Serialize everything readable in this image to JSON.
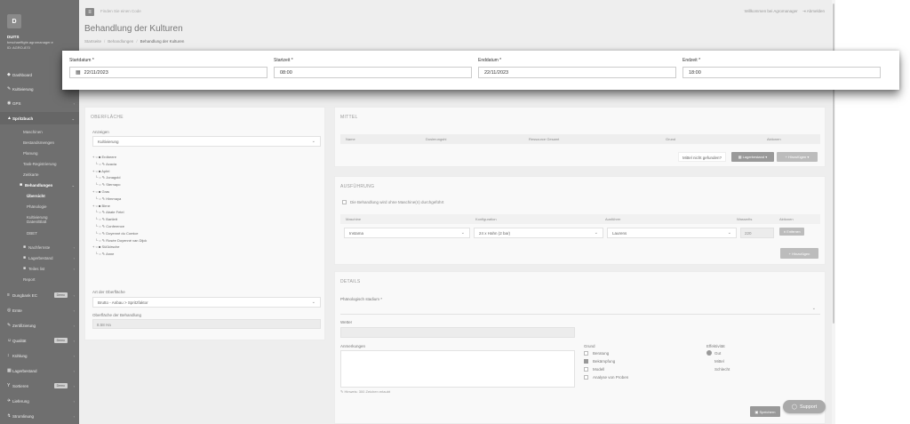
{
  "sidebar": {
    "logo": "D",
    "company": "DUITS",
    "email": "beschaeftigte.agromanager.e",
    "id_line": "ID: AGRO-870",
    "items": [
      {
        "label": "Dashboard",
        "icon": "◆"
      },
      {
        "label": "Kultivierung",
        "icon": "✎"
      },
      {
        "label": "GPS",
        "icon": "◉"
      },
      {
        "label": "Spritzbuch",
        "icon": "▲"
      }
    ],
    "sub_items": [
      {
        "label": "Maschinen"
      },
      {
        "label": "Bestandsmengen"
      },
      {
        "label": "Planung"
      },
      {
        "label": "Task-Registrierung"
      },
      {
        "label": "Zeitkarte"
      },
      {
        "label": "Behandlungen"
      }
    ],
    "sub2_items": [
      {
        "label": "Übersicht"
      },
      {
        "label": "Phänologie"
      },
      {
        "label": "Kultivierung Daten/Blatt"
      },
      {
        "label": "DBET"
      }
    ],
    "sub_items_b": [
      {
        "label": "Nachfernste"
      },
      {
        "label": "Lagerbestand"
      },
      {
        "label": "Teiles list"
      },
      {
        "label": "Report"
      }
    ],
    "bottom_items": [
      {
        "label": "Dungbank EC",
        "icon": "≡",
        "badge": "Demo"
      },
      {
        "label": "Ernte",
        "icon": "◎"
      },
      {
        "label": "Zertifizierung",
        "icon": "✎"
      },
      {
        "label": "Qualität",
        "icon": "☺",
        "badge": "Demo"
      },
      {
        "label": "Kühlung",
        "icon": "↕"
      },
      {
        "label": "Lagerbestand",
        "icon": "▦"
      },
      {
        "label": "Sortieren",
        "icon": "Y",
        "badge": "Demo"
      },
      {
        "label": "Lieferung",
        "icon": "✈"
      },
      {
        "label": "Stromlinung",
        "icon": "↯"
      }
    ]
  },
  "topbar": {
    "search_placeholder": "Finden Sie einen Code",
    "welcome": "Willkommen bei Agromanager",
    "logout": "Abmelden"
  },
  "page": {
    "title": "Behandlung der Kulturen",
    "breadcrumb": [
      "Startseite",
      "Behandlungen",
      "Behandlung der Kulturen"
    ]
  },
  "date_bar": {
    "start_date_label": "Startdatum *",
    "start_date": "22/11/2023",
    "start_time_label": "Startzeit *",
    "start_time": "08:00",
    "end_date_label": "Enddatum *",
    "end_date": "22/11/2023",
    "end_time_label": "Endzeit *",
    "end_time": "18:00"
  },
  "surface_panel": {
    "title": "OBERFLÄCHE",
    "show_label": "Anzeigen",
    "show_value": "Kultivierung",
    "tree": [
      {
        "label": "Erdbeere",
        "level": 0
      },
      {
        "label": "Acacia",
        "level": 1
      },
      {
        "label": "Apfel",
        "level": 0
      },
      {
        "label": "Jonagold",
        "level": 1
      },
      {
        "label": "Sternapo",
        "level": 1
      },
      {
        "label": "Gras",
        "level": 0
      },
      {
        "label": "Himmaya",
        "level": 1
      },
      {
        "label": "Birne",
        "level": 0
      },
      {
        "label": "Abate Fetel",
        "level": 1
      },
      {
        "label": "Bartlett",
        "level": 1
      },
      {
        "label": "Conference",
        "level": 1
      },
      {
        "label": "Doyenné du Comice",
        "level": 1
      },
      {
        "label": "Rosée Doyenné van Dijck",
        "level": 1
      },
      {
        "label": "Süßkirsche",
        "level": 0
      },
      {
        "label": "Anne",
        "level": 1
      }
    ],
    "surface_type_label": "Art der Oberfläche",
    "surface_type_value": "Brutto - Anbau > Spritzfaktor",
    "treated_label": "Oberfläche der Behandlung",
    "treated_value": "8.58 Ha"
  },
  "means_panel": {
    "title": "MITTEL",
    "columns": [
      "Name",
      "Dosierungshi",
      "Ressource Gesamt",
      "Grund",
      "Aktionen"
    ],
    "not_found": "Mittel nicht gefunden?",
    "stock_button": "Lagerbestand",
    "add_button": "Hinzufügen"
  },
  "execution_panel": {
    "title": "AUSFÜHRUNG",
    "no_machine": "Die Behandlung wird ohne Maschine(n) durchgeführt",
    "columns": [
      "Maschine",
      "Konfiguration",
      "Ausführer",
      "Wasserlts",
      "Aktionen"
    ],
    "row": {
      "machine": "Instama",
      "config": "24 x Hahn (2 bar)",
      "operator": "Laurens",
      "water": "220",
      "action": "Entfernen"
    },
    "add_button": "Hinzufügen"
  },
  "details_panel": {
    "title": "DETAILS",
    "pheno_label": "Phänologisch stadium *",
    "weather_label": "Wetter",
    "notes_label": "Anmerkungen",
    "notes_hint": "Hinweis: 300 Zeichen erlaubt",
    "reason_label": "Grund",
    "reasons": [
      {
        "label": "Beratung",
        "checked": false
      },
      {
        "label": "Bekämpfung",
        "checked": true
      },
      {
        "label": "Modell",
        "checked": false
      },
      {
        "label": "Analyse von Proben",
        "checked": false
      }
    ],
    "effect_label": "Effektivität",
    "effects": [
      "Gut",
      "Mittel",
      "Schlecht"
    ],
    "save_button": "Speichern"
  },
  "support": {
    "label": "Support"
  }
}
